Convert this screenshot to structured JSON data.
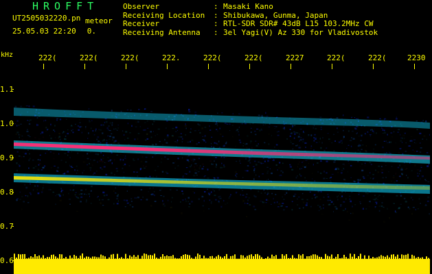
{
  "header": {
    "title": "HROFFT",
    "filename": "UT2505032220.pn",
    "meteor_label": "meteor",
    "date_time": "25.05.03 22:20",
    "sequence": "0."
  },
  "station_info": [
    {
      "label": "Observer",
      "value": "Masaki Kano"
    },
    {
      "label": "Receiving Location",
      "value": "Shibukawa, Gunma, Japan"
    },
    {
      "label": "Receiver",
      "value": "RTL-SDR SDR# 43dB L15 103.2MHz CW"
    },
    {
      "label": "Receiving Antenna",
      "value": "3el Yagi(V) Az 330 for Vladivostok"
    }
  ],
  "spectrogram": {
    "y_unit": "kHz",
    "y_range": [
      0.6,
      1.1
    ],
    "y_ticks": [
      "1.1",
      "1.0",
      "0.9",
      "0.8",
      "0.7",
      "0.6"
    ],
    "x_ticks": [
      "222(",
      "222(",
      "222(",
      "222.",
      "222(",
      "222(",
      "2227",
      "222(",
      "222(",
      "2230"
    ],
    "colors": {
      "background": "#000000",
      "axis_text": "#ffff00",
      "title_text": "#2dff63",
      "signal_low": "#1234ff",
      "signal_mid": "#12d7ff",
      "signal_high": "#ffea00",
      "signal_peak": "#ff2d75"
    }
  }
}
